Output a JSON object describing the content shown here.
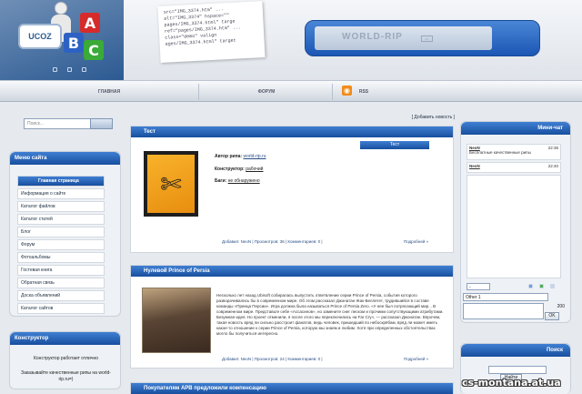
{
  "header": {
    "logo_text": "UCOZ",
    "cubes": [
      "A",
      "B",
      "C"
    ],
    "code_snippet": [
      "src=\"IMG_3374.htm\" ...",
      "alt=\"IMG_3374\" hspace=\"\"",
      "pages/IMG_3374.html\" targe",
      "ref=\"pages/IMG_3374.htm\" ...",
      "class=\"demo\" valign",
      "ages/IMG_3374.html\" target"
    ],
    "banner_brand": "WORLD-RIP",
    "banner_tag": "v2"
  },
  "nav": {
    "items": [
      "ГЛАВНАЯ",
      "ФОРУМ",
      "RSS"
    ]
  },
  "left": {
    "search_placeholder": "Поиск...",
    "menu_title": "Меню сайта",
    "menu_items": [
      "Главная страница",
      "Информация о сайте",
      "Каталог файлов",
      "Каталог статей",
      "Блог",
      "Форум",
      "Фотоальбомы",
      "Гостевая книга",
      "Обратная связь",
      "Доска объявлений",
      "Каталог сайтов"
    ],
    "constructor_title": "Конструктор",
    "constructor_text1": "Конструктор работает отлично",
    "constructor_text2": "Заказывайте качественные рипы на world-rip.ru=)"
  },
  "main": {
    "add_news": "[ Добавить новость ]",
    "post1": {
      "title": "Тест",
      "tab": "Тест",
      "author_label": "Автор рипа:",
      "author_value": "world-rip.ru",
      "constructor_label": "Конструктор:",
      "constructor_value": "рабочий",
      "bugs_label": "Баги:",
      "bugs_value": "не обнаружено",
      "meta": "Добавил: NeoN | Просмотров: 36 | Комментариев: 0 |",
      "more": "Подробней »"
    },
    "post2": {
      "title": "Нулевой Prince of Persia",
      "text": "Несколько лет назад Ubisoft собиралась выпустить ответвление серии Prince of Persia, события которого разворачивались бы в современном мире. Об этом рассказал Джонатан Жак-Беллетет, трудившийся в составе команды «Принца Персии». Игра должна была называться Prince of Persia Zero. «У нее был потрясающий мир... В современном мире. Представьте себе «Ассасинов», но замените снег песком и прочими сопутствующими атрибутами. Безумная идея. Но проект отменили, я после этого мы переключились на Far Cry», — рассказал Джонатан. Впрочем, такая новость вряд ли сильно расстроит фанатов, ведь человек, пришедший по небоскрёбам, вряд ли может иметь какое-то отношение к серии Prince of Persia, которую мы знаем и любим. Хотя при определенных обстоятельствах могло бы получиться интересно.",
      "meta": "Добавил: NeoN | Просмотров: 24 | Комментариев: 0 |",
      "more": "Подробней »"
    },
    "post3": {
      "title": "Покупателям APB предложили компенсацию"
    }
  },
  "right": {
    "chat_title": "Мини-чат",
    "messages": [
      {
        "user": "NeoN",
        "time": "22:36",
        "text": "Бесплатные качественные рипы"
      },
      {
        "user": "NeoN",
        "time": "22:40",
        "text": ""
      }
    ],
    "select_value": "-",
    "name_value": "Other 1",
    "counter": "200",
    "ok_label": "OK",
    "search_title": "Поиск",
    "search_button": "Найти"
  },
  "watermark": "cs-montana.at.ua"
}
